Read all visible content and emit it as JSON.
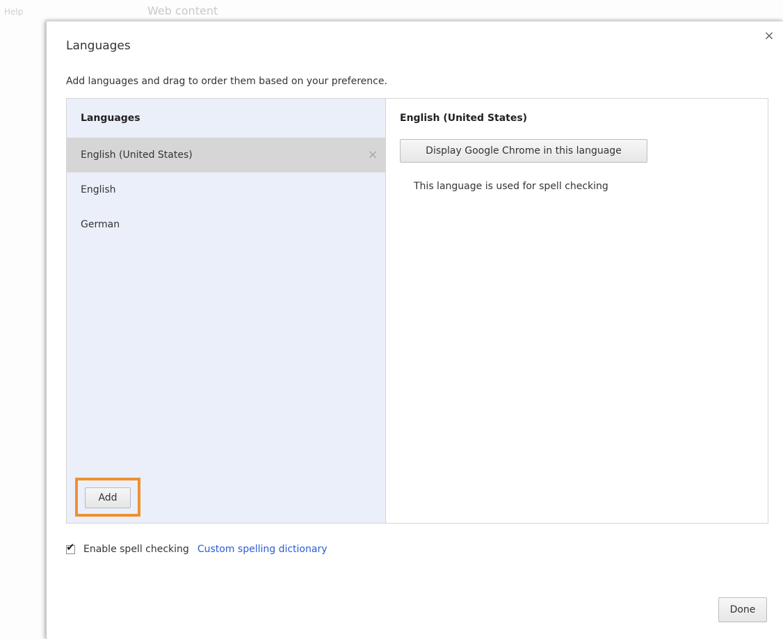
{
  "background": {
    "help_label": "Help",
    "section_label": "Web content"
  },
  "dialog": {
    "title": "Languages",
    "close_glyph": "×",
    "description": "Add languages and drag to order them based on your preference.",
    "left_pane": {
      "header": "Languages",
      "items": [
        {
          "label": "English (United States)",
          "selected": true,
          "remove_glyph": "×"
        },
        {
          "label": "English",
          "selected": false
        },
        {
          "label": "German",
          "selected": false
        }
      ],
      "add_button": "Add",
      "highlight_color": "#f0902f"
    },
    "right_pane": {
      "header": "English (United States)",
      "display_button": "Display Google Chrome in this language",
      "spell_note": "This language is used for spell checking"
    },
    "spell_check": {
      "checked": true,
      "label": "Enable spell checking",
      "link": "Custom spelling dictionary"
    },
    "done_button": "Done"
  },
  "icons": {
    "close": "close-icon",
    "remove": "remove-icon",
    "check": "checkmark-icon"
  }
}
